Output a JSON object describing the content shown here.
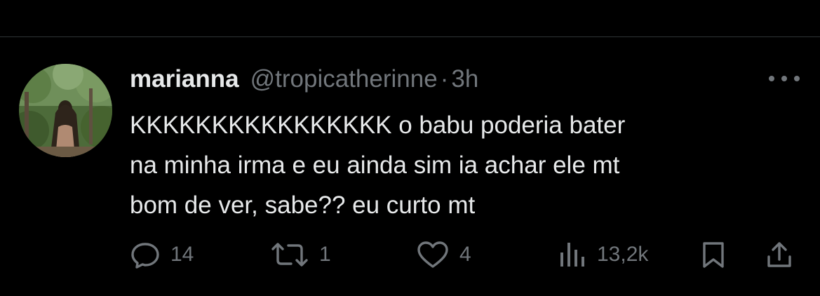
{
  "tweet": {
    "author_name": "marianna",
    "handle": "@tropicatherinne",
    "separator": "·",
    "time": "3h",
    "text_lines": [
      "KKKKKKKKKKKKKKKK o babu poderia bater",
      "na minha irma e eu ainda sim ia achar ele mt",
      "bom de ver, sabe?? eu curto mt"
    ]
  },
  "actions": {
    "replies": "14",
    "retweets": "1",
    "likes": "4",
    "views": "13,2k"
  },
  "icons": {
    "avatar": "avatar-photo",
    "more": "more-options-icon",
    "reply": "reply-icon",
    "retweet": "retweet-icon",
    "like": "heart-icon",
    "views": "views-bar-chart-icon",
    "bookmark": "bookmark-icon",
    "share": "share-icon"
  },
  "colors": {
    "background": "#000000",
    "primary_text": "#e7e9ea",
    "secondary_text": "#71767b",
    "divider": "#2f3336"
  }
}
